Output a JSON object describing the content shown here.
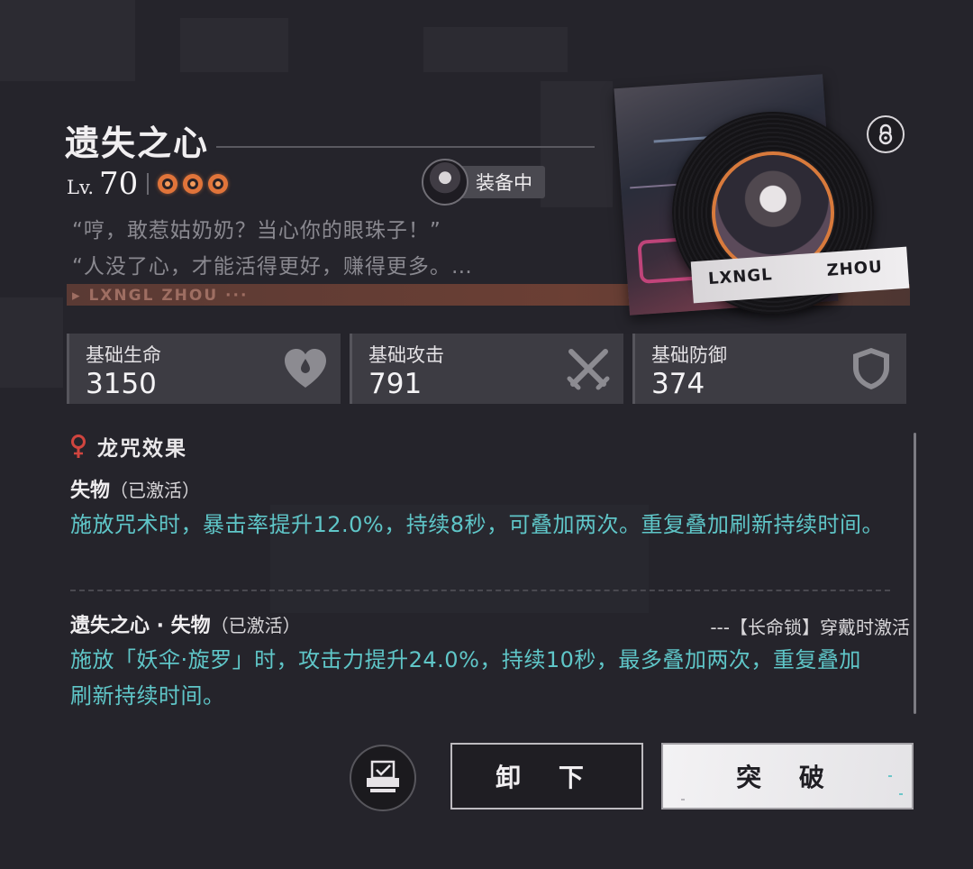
{
  "item": {
    "name": "遗失之心",
    "level_prefix": "Lv.",
    "level": "70",
    "star_count": 3,
    "equipped_label": "装备中",
    "quotes": [
      "“哼，敢惹姑奶奶？当心你的眼珠子！”",
      "“人没了心，才能活得更好，赚得更多。…"
    ],
    "brand_band": "▸ LXNGL ZHOU ···",
    "cover_texts": [
      "LXNGL",
      "ZHOU"
    ]
  },
  "stats": [
    {
      "label": "基础生命",
      "value": "3150",
      "icon": "heart-drop-icon"
    },
    {
      "label": "基础攻击",
      "value": "791",
      "icon": "crossed-swords-icon"
    },
    {
      "label": "基础防御",
      "value": "374",
      "icon": "shield-icon"
    }
  ],
  "effects_section": {
    "title": "龙咒效果",
    "effects": [
      {
        "name": "失物",
        "status": "（已激活）",
        "description": "施放咒术时，暴击率提升12.0%，持续8秒，可叠加两次。重复叠加刷新持续时间。"
      },
      {
        "name": "遗失之心 · 失物",
        "status": "（已激活）",
        "condition": "---【长命锁】穿戴时激活",
        "description": "施放「妖伞·旋罗」时，攻击力提升24.0%，持续10秒，最多叠加两次，重复叠加刷新持续时间。"
      }
    ]
  },
  "actions": {
    "unequip_label": "卸 下",
    "breakthrough_label": "突 破"
  },
  "colors": {
    "background": "#25242b",
    "accent_cyan": "#5fc6c8",
    "star_orange": "#e0743a",
    "effect_marker_red": "#d0453f"
  }
}
